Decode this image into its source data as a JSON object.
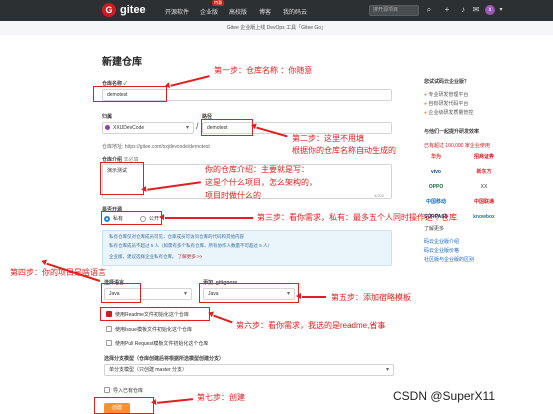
{
  "nav": {
    "brand": "gitee",
    "logo": "G",
    "links": [
      "开源软件",
      "企业版",
      "高校版",
      "博客",
      "我的码云"
    ],
    "badge": "特惠",
    "search_placeholder": "搜开源项目",
    "avatar": "x"
  },
  "banner": {
    "text": "Gitee 企业版上线 DevOps 工具「Gitee Go」",
    "link": "Gitee Go"
  },
  "page_title": "新建仓库",
  "form": {
    "repo_name_label": "仓库名称",
    "repo_name_check": "✓",
    "repo_name_value": "demotest",
    "owner_label": "归属",
    "owner_value": "XXUDevCode",
    "path_label": "路径",
    "path_value": "demotest",
    "slash": "/",
    "address_label": "仓库地址:",
    "address_value": "https://gitee.com/xxjdevcode/demotest",
    "desc_label": "仓库介绍",
    "desc_optional": "非必填",
    "desc_value": "演示测试",
    "desc_count": "4/200",
    "visibility_label": "是否开源",
    "private_label": "私有",
    "public_label": "公开",
    "private_note1": "私有仓库仅对仓库成员可见，仓库成员可访问仓库的代码和其他内容",
    "private_note2": "私有仓库成员不超过 5 人（如需有多个私有仓库，所有协作人数量不可超过 5 人）",
    "private_note3": "企业版，建议选择企业私有仓库。",
    "private_note_link": "了解更多 >>",
    "lang_label": "选择语言",
    "lang_value": "Java",
    "gitignore_label": "添加 .gitignore",
    "gitignore_value": "Java",
    "opt_readme": "使用Readme文件初始化这个仓库",
    "opt_issue": "使用Issue模板文件初始化这个仓库",
    "opt_pr": "使用Pull Request模板文件初始化这个仓库",
    "branch_label": "选择分支模型（仓库创建后将根据所选模型创建分支）",
    "branch_value": "单分支模型（只创建 master 分支）",
    "import_label": "导入已有仓库",
    "create_label": "创建"
  },
  "sidebar": {
    "q_title": "您试试码云企业版？",
    "points": [
      "专业研发管理平台",
      "自有研发代码平台",
      "企业级研发质量管控"
    ],
    "logos_title": "与他们一起提升研发效率",
    "customers_line": "已有超过 100,000 家企业使用",
    "logos": [
      "华为",
      "招商证券",
      "vivo",
      "新东方",
      "OPPO",
      "XX",
      "中国移动",
      "中国联通",
      "SURPASS",
      "knowbox"
    ],
    "learn_more": "了解更多",
    "links": [
      "码云企业版介绍",
      "码云企业版价格",
      "社区版与企业版的区别"
    ]
  },
  "annotations": {
    "step1": "第一步：仓库名称  ：你随意",
    "step2a": "第二步：这里不用填",
    "step2b": "根据你的仓库名称自动生成的",
    "desc_a": "你的仓库介绍：主要就是写：",
    "desc_b": "这是个什么项目，怎么架构的，",
    "desc_c": "项目时做什么的",
    "step3": "第三步：看你需求，私有：最多五个人同时操作这个仓库",
    "step4": "第四步：你的项目是啥语言",
    "step5": "第五步：添加宿略模板",
    "step6": "第六步：看你需求，我选的是readme,省事",
    "step7": "第七步：创建"
  },
  "watermark": "CSDN @SuperX11"
}
